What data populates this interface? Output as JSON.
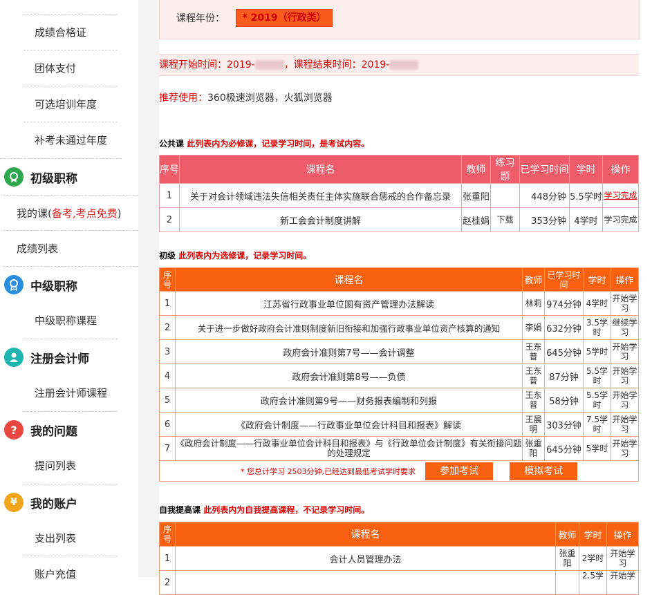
{
  "sidebar": {
    "sub_top": [
      "成绩合格证",
      "团体支付",
      "可选培训年度",
      "补考未通过年度"
    ],
    "junior": {
      "title": "初级职称",
      "my_course_prefix": "我的课(",
      "my_course_red": "备考,考点免费",
      "my_course_suffix": ")",
      "score_list": "成绩列表"
    },
    "middle": {
      "title": "中级职称",
      "course": "中级职称课程"
    },
    "cpa": {
      "title": "注册会计师",
      "course": "注册会计师课程"
    },
    "question": {
      "title": "我的问题",
      "list": "提问列表"
    },
    "account": {
      "title": "我的账户",
      "expense": "支出列表",
      "recharge": "账户充值"
    }
  },
  "year": {
    "label": "课程年份：",
    "value": "* 2019（行政类）"
  },
  "time": {
    "start_label": "课程开始时间：2019-",
    "end_label": "，课程结束时间：2019-"
  },
  "recommend": {
    "label": "推荐使用：",
    "value": "360极速浏览器，火狐浏览器"
  },
  "public_section": {
    "title": "公共课",
    "note": "此列表内为必修课，记录学习时间，是考试内容。",
    "headers": [
      "序号",
      "课程名",
      "教师",
      "练习题",
      "已学习时间",
      "学时",
      "操作"
    ],
    "rows": [
      {
        "no": "1",
        "name": "关于对会计领域违法失信相关责任主体实施联合惩戒的合作备忘录",
        "teacher": "张重阳",
        "exercise": "",
        "studied": "448分钟",
        "hours": "5.5学时",
        "action": "学习完成"
      },
      {
        "no": "2",
        "name": "新工会会计制度讲解",
        "teacher": "赵桂娟",
        "exercise": "下载",
        "studied": "353分钟",
        "hours": "4学时",
        "action": "学习完成"
      }
    ]
  },
  "junior_section": {
    "title": "初级",
    "note": "此列表内为选修课，记录学习时间。",
    "headers": [
      "序号",
      "课程名",
      "教师",
      "已学习时间",
      "学时",
      "操作"
    ],
    "rows": [
      {
        "no": "1",
        "name": "江苏省行政事业单位国有资产管理办法解读",
        "teacher": "林莉",
        "studied": "974分钟",
        "hours": "4学时",
        "action": "开始学习"
      },
      {
        "no": "2",
        "name": "关于进一步做好政府会计准则制度新旧衔接和加强行政事业单位资产核算的通知",
        "teacher": "李娟",
        "studied": "632分钟",
        "hours": "3.5学时",
        "action": "继续学习"
      },
      {
        "no": "3",
        "name": "政府会计准则第7号——会计调整",
        "teacher": "王东普",
        "studied": "645分钟",
        "hours": "5学时",
        "action": "开始学习"
      },
      {
        "no": "4",
        "name": "政府会计准则第8号——负债",
        "teacher": "王东普",
        "studied": "87分钟",
        "hours": "5.5学时",
        "action": "开始学习"
      },
      {
        "no": "5",
        "name": "政府会计准则第9号——财务报表编制和列报",
        "teacher": "王东普",
        "studied": "58分钟",
        "hours": "5.5学时",
        "action": "开始学习"
      },
      {
        "no": "6",
        "name": "《政府会计制度——行政事业单位会计科目和报表》解读",
        "teacher": "王晨明",
        "studied": "303分钟",
        "hours": "7.5学时",
        "action": "开始学习"
      },
      {
        "no": "7",
        "name": "《政府会计制度——行政事业单位会计科目和报表》与《行政单位会计制度》有关衔接问题的处理规定",
        "teacher": "张重阳",
        "studied": "645分钟",
        "hours": "5学时",
        "action": "开始学习"
      }
    ],
    "footer_note": "* 您总计学习 2503分钟,已经达到最低考试学时要求",
    "exam_button": "参加考试",
    "mock_button": "模拟考试"
  },
  "self_section": {
    "title": "自我提高课",
    "note": "此列表内为自我提高课程，不记录学习时间。",
    "headers": [
      "序号",
      "课程名",
      "教师",
      "学时",
      "操作"
    ],
    "rows": [
      {
        "no": "1",
        "name": "会计人员管理办法",
        "teacher": "张重阳",
        "hours": "2学时",
        "action": "开始学习"
      },
      {
        "no": "2",
        "name": "",
        "teacher": "",
        "hours": "2.5学",
        "action": "开始学"
      }
    ]
  },
  "colors": {
    "orange": "#f76111",
    "pink_header": "#ee5c6a",
    "red_text": "#dd0000"
  }
}
